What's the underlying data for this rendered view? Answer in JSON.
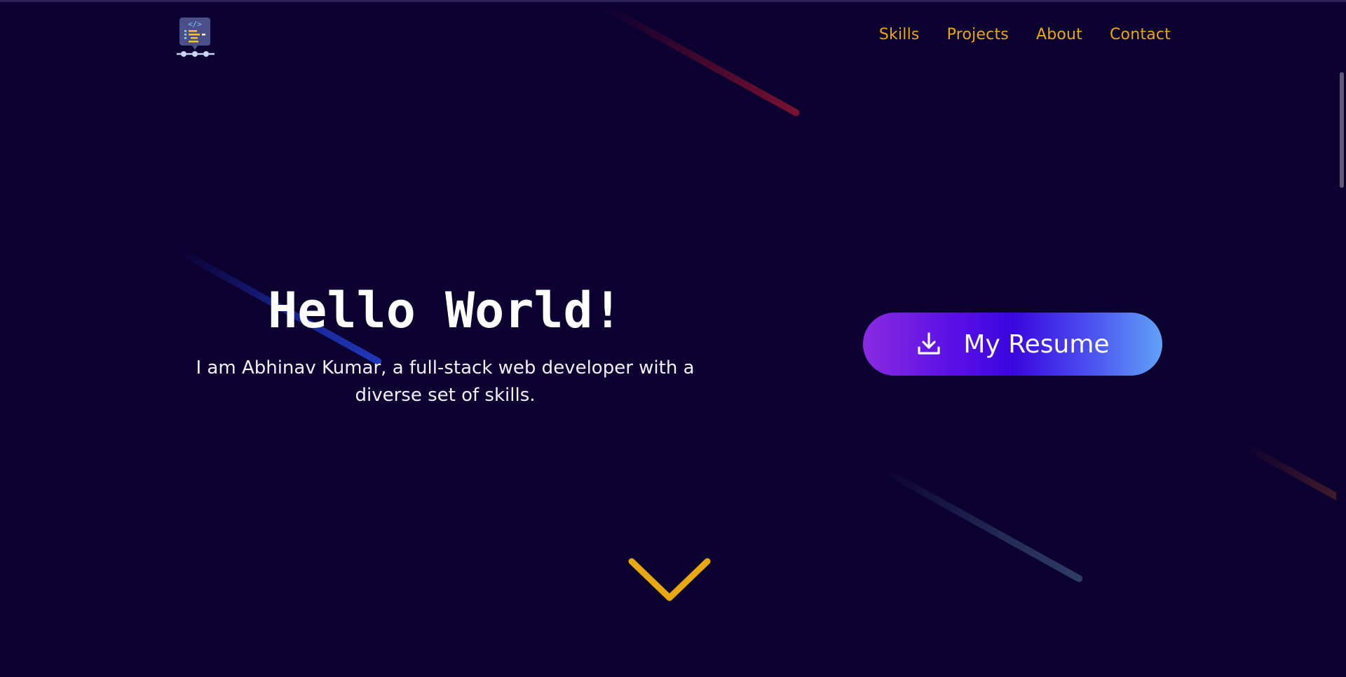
{
  "header": {
    "logo_icon": "code-monitor-logo-icon",
    "nav": [
      {
        "label": "Skills"
      },
      {
        "label": "Projects"
      },
      {
        "label": "About"
      },
      {
        "label": "Contact"
      }
    ]
  },
  "hero": {
    "title": "Hello World!",
    "subtitle": "I am Abhinav Kumar, a full-stack web developer with a diverse set of skills.",
    "resume_button": {
      "label": "My Resume",
      "icon": "download-icon"
    },
    "scroll_icon": "chevron-down-icon"
  },
  "colors": {
    "background": "#0b0030",
    "nav_link": "#e8a810",
    "chevron": "#e8a810",
    "button_gradient_start": "#8a2be2",
    "button_gradient_mid": "#3a06df",
    "button_gradient_end": "#62a1f7"
  }
}
